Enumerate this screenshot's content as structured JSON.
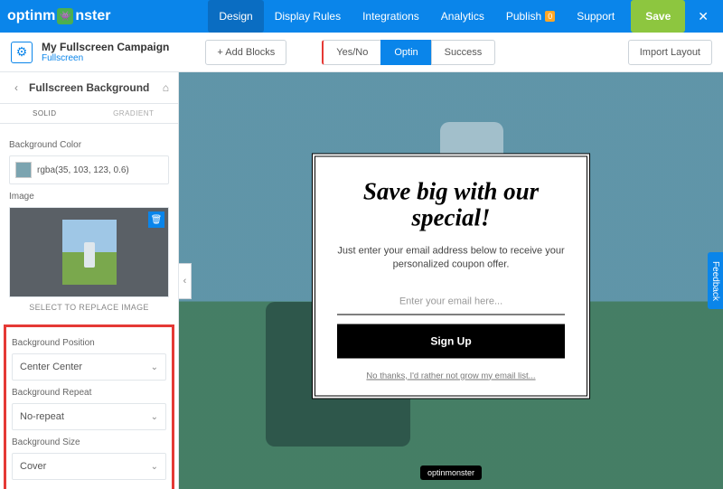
{
  "brand": {
    "pre": "optinm",
    "post": "nster"
  },
  "topnav": {
    "design": "Design",
    "display_rules": "Display Rules",
    "integrations": "Integrations",
    "analytics": "Analytics",
    "publish": "Publish",
    "support": "Support",
    "save": "Save",
    "publish_badge": "0"
  },
  "campaign": {
    "title": "My Fullscreen Campaign",
    "subtitle": "Fullscreen"
  },
  "subbar": {
    "add_blocks": "+ Add Blocks",
    "import": "Import Layout"
  },
  "steps": {
    "yesno": "Yes/No",
    "optin": "Optin",
    "success": "Success"
  },
  "sidebar": {
    "title": "Fullscreen Background",
    "tab_solid": "SOLID",
    "tab_gradient": "GRADIENT",
    "bg_color_label": "Background Color",
    "bg_color_value": "rgba(35, 103, 123, 0.6)",
    "image_label": "Image",
    "image_caption": "SELECT TO REPLACE IMAGE",
    "bg_pos_label": "Background Position",
    "bg_pos_value": "Center Center",
    "bg_repeat_label": "Background Repeat",
    "bg_repeat_value": "No-repeat",
    "bg_size_label": "Background Size",
    "bg_size_value": "Cover"
  },
  "popup": {
    "headline": "Save big with our special!",
    "subtext": "Just enter your email address below to receive your personalized coupon offer.",
    "email_placeholder": "Enter your email here...",
    "signup": "Sign Up",
    "nothanks": "No thanks, I'd rather not grow my email list..."
  },
  "feedback_label": "Feedback",
  "om_badge": "optinmonster"
}
